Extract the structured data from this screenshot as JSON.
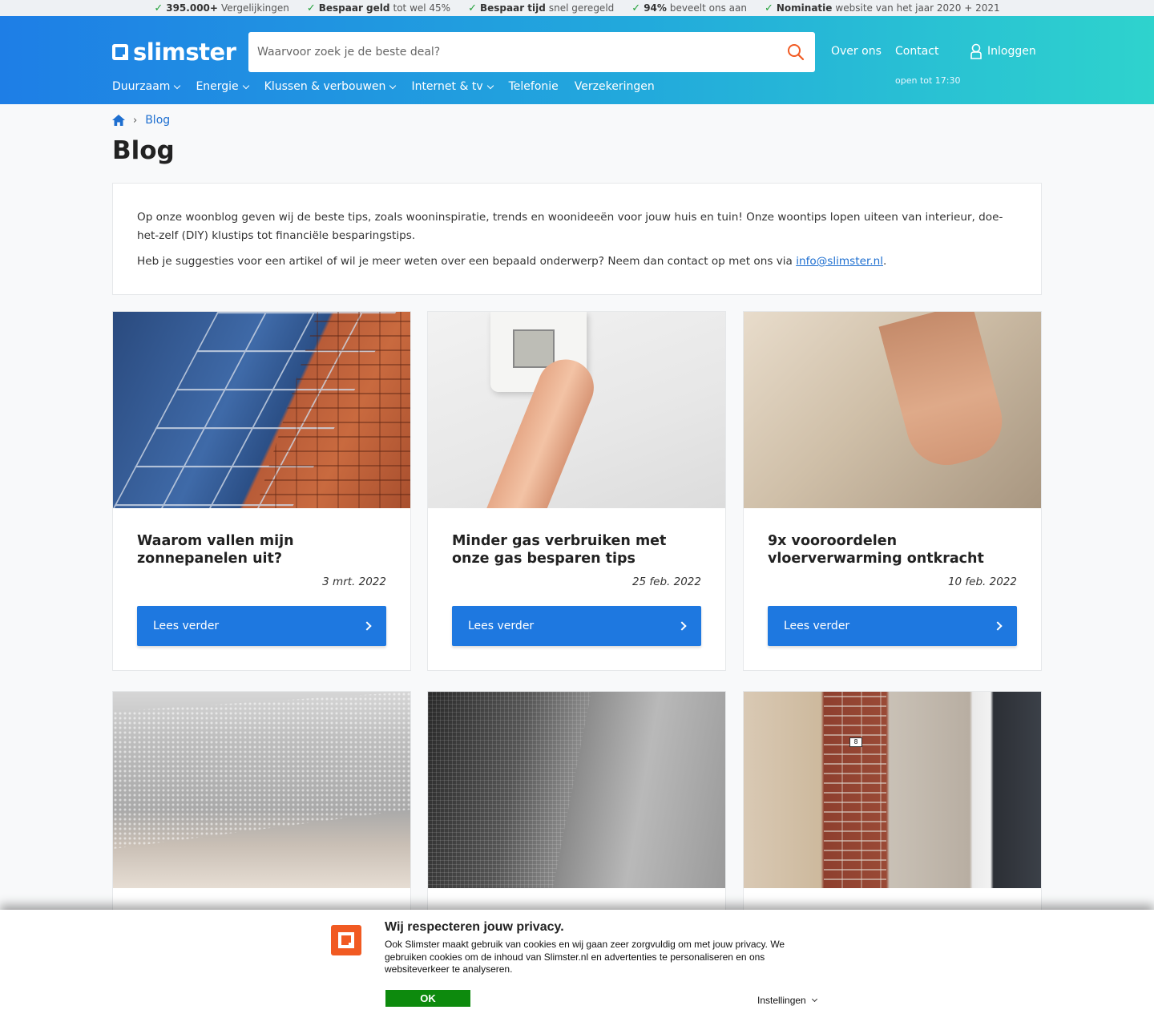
{
  "usp": [
    {
      "bold": "395.000+",
      "text": "Vergelijkingen"
    },
    {
      "bold": "Bespaar geld",
      "text": "tot wel 45%"
    },
    {
      "bold": "Bespaar tijd",
      "text": "snel geregeld"
    },
    {
      "bold": "94%",
      "text": "beveelt ons aan"
    },
    {
      "bold": "Nominatie",
      "text": "website van het jaar 2020 + 2021"
    }
  ],
  "header": {
    "logo": "slimster",
    "search_placeholder": "Waarvoor zoek je de beste deal?",
    "over_ons": "Over ons",
    "contact": "Contact",
    "contact_sub": "open tot 17:30",
    "login": "Inloggen"
  },
  "nav": [
    {
      "label": "Duurzaam",
      "dropdown": true
    },
    {
      "label": "Energie",
      "dropdown": true
    },
    {
      "label": "Klussen & verbouwen",
      "dropdown": true
    },
    {
      "label": "Internet & tv",
      "dropdown": true
    },
    {
      "label": "Telefonie",
      "dropdown": false
    },
    {
      "label": "Verzekeringen",
      "dropdown": false
    }
  ],
  "breadcrumb": {
    "current": "Blog"
  },
  "page_title": "Blog",
  "intro": {
    "p1": "Op onze woonblog geven wij de beste tips, zoals wooninspiratie, trends en woonideeën voor jouw huis en tuin! Onze woontips lopen uiteen van interieur, doe-het-zelf (DIY) klustips tot financiële besparingstips.",
    "p2_before": "Heb je suggesties voor een artikel of wil je meer weten over een bepaald onderwerp? Neem dan contact op met ons via ",
    "p2_link": "info@slimster.nl",
    "p2_after": "."
  },
  "cards": [
    {
      "title": "Waarom vallen mijn zonnepanelen uit?",
      "date": "3 mrt. 2022",
      "button": "Lees verder"
    },
    {
      "title": "Minder gas verbruiken met onze gas besparen tips",
      "date": "25 feb. 2022",
      "button": "Lees verder"
    },
    {
      "title": "9x vooroordelen vloerverwarming ontkracht",
      "date": "10 feb. 2022",
      "button": "Lees verder"
    }
  ],
  "cookie": {
    "title": "Wij respecteren jouw privacy.",
    "text": "Ook Slimster maakt gebruik van cookies en wij gaan zeer zorgvuldig om met jouw privacy. We gebruiken cookies om de inhoud van Slimster.nl en advertenties te personaliseren en ons websiteverkeer te analyseren.",
    "ok": "OK",
    "settings": "Instellingen"
  },
  "colors": {
    "primary": "#1e78e0",
    "header_start": "#1e7ee6",
    "header_end": "#2ed3cd",
    "check": "#23a23a",
    "cookie_ok": "#0d8a0d",
    "cookie_brand": "#f15a22"
  }
}
